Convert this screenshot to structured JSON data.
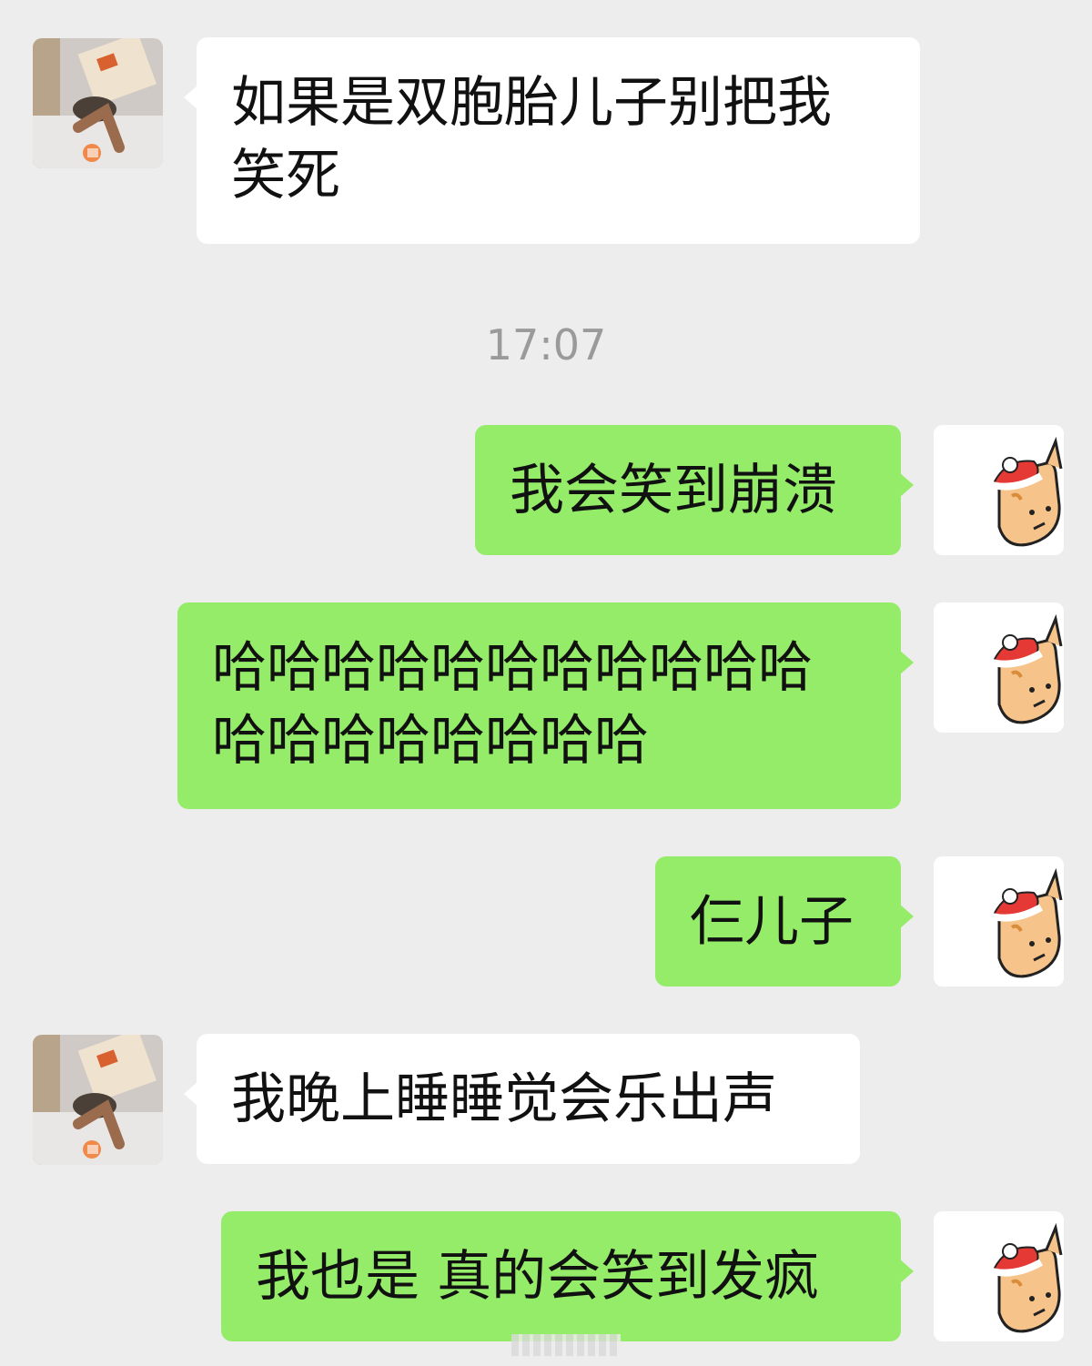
{
  "messages": [
    {
      "id": "m1",
      "side": "left",
      "text": "如果是双胞胎儿子别把我\n笑死"
    },
    {
      "id": "m2",
      "side": "right",
      "text": "我会笑到崩溃"
    },
    {
      "id": "m3",
      "side": "right",
      "text": "哈哈哈哈哈哈哈哈哈哈哈\n哈哈哈哈哈哈哈哈"
    },
    {
      "id": "m4",
      "side": "right",
      "text": "仨儿子"
    },
    {
      "id": "m5",
      "side": "left",
      "text": "我晚上睡睡觉会乐出声"
    },
    {
      "id": "m6",
      "side": "right",
      "text": "我也是 真的会笑到发疯"
    }
  ],
  "timestamp": "17:07",
  "colors": {
    "background": "#ededed",
    "sent_bubble": "#95ec69",
    "received_bubble": "#ffffff",
    "timestamp_text": "#9a9a9a"
  },
  "icons": {
    "left_avatar": "child-photo-avatar",
    "right_avatar": "cat-santa-hat-avatar"
  }
}
